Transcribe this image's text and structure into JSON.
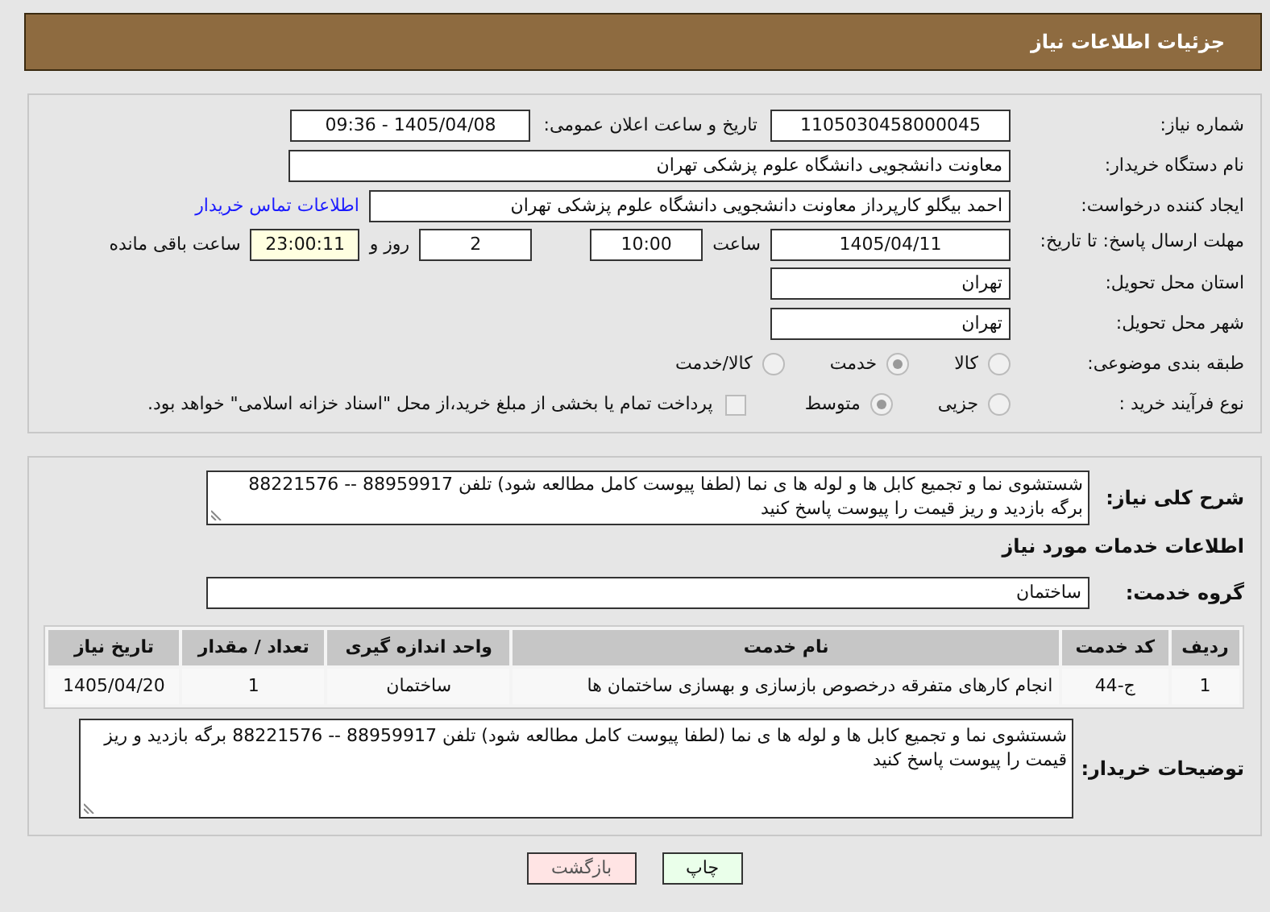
{
  "header": {
    "title": "جزئیات اطلاعات نیاز"
  },
  "details": {
    "need_number": {
      "label": "شماره نیاز:",
      "value": "1105030458000045"
    },
    "announce": {
      "label": "تاریخ و ساعت اعلان عمومی:",
      "value": "1405/04/08 - 09:36"
    },
    "buyer_org": {
      "label": "نام دستگاه خریدار:",
      "value": "معاونت دانشجویی دانشگاه علوم پزشکی تهران"
    },
    "creator": {
      "label": "ایجاد کننده درخواست:",
      "value": "احمد بیگلو کارپرداز معاونت دانشجویی دانشگاه علوم پزشکی تهران",
      "link": "اطلاعات تماس خریدار"
    },
    "deadline": {
      "label": "مهلت ارسال پاسخ: تا تاریخ:",
      "date": "1405/04/11",
      "time_label": "ساعت",
      "time": "10:00",
      "days": "2",
      "days_label": "روز و",
      "remaining": "23:00:11",
      "remaining_label": "ساعت باقی مانده"
    },
    "province": {
      "label": "استان محل تحویل:",
      "value": "تهران"
    },
    "city": {
      "label": "شهر محل تحویل:",
      "value": "تهران"
    },
    "category": {
      "label": "طبقه بندی موضوعی:",
      "options": [
        {
          "label": "کالا",
          "selected": false
        },
        {
          "label": "خدمت",
          "selected": true
        },
        {
          "label": "کالا/خدمت",
          "selected": false
        }
      ]
    },
    "process": {
      "label": "نوع فرآیند خرید :",
      "options": [
        {
          "label": "جزیی",
          "selected": false
        },
        {
          "label": "متوسط",
          "selected": true
        }
      ],
      "payment": {
        "checked": false,
        "label": "پرداخت تمام یا بخشی از مبلغ خرید،از محل \"اسناد خزانه اسلامی\" خواهد بود."
      }
    }
  },
  "services": {
    "description": {
      "label": "شرح کلی نیاز:",
      "value": "شستشوی نما و تجمیع کابل ها و لوله ها ی نما (لطفا پیوست کامل مطالعه شود) تلفن 88959917 -- 88221576 برگه بازدید و ریز قیمت را پیوست پاسخ کنید"
    },
    "heading": "اطلاعات خدمات مورد نیاز",
    "group": {
      "label": "گروه خدمت:",
      "value": "ساختمان"
    },
    "table": {
      "columns": [
        "ردیف",
        "کد خدمت",
        "نام خدمت",
        "واحد اندازه گیری",
        "تعداد / مقدار",
        "تاریخ نیاز"
      ],
      "rows": [
        [
          "1",
          "ج-44",
          "انجام کارهای متفرقه درخصوص بازسازی و بهسازی ساختمان ها",
          "ساختمان",
          "1",
          "1405/04/20"
        ]
      ]
    },
    "buyer_notes": {
      "label": "توضیحات خریدار:",
      "value": "شستشوی نما و تجمیع کابل ها و لوله ها ی نما (لطفا پیوست کامل مطالعه شود) تلفن 88959917 -- 88221576 برگه بازدید و ریز قیمت را پیوست پاسخ کنید"
    }
  },
  "buttons": [
    {
      "kind": "print",
      "label": "چاپ"
    },
    {
      "kind": "back",
      "label": "بازگشت"
    }
  ]
}
